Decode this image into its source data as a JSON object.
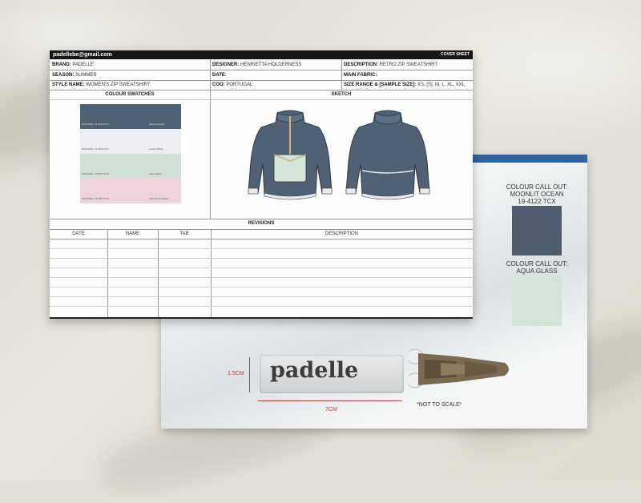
{
  "cover_sheet": {
    "email": "padellebe@gmail.com",
    "cover_label": "COVER SHEET",
    "fields": {
      "brand": {
        "label": "BRAND:",
        "value": "PADELLE"
      },
      "season": {
        "label": "SEASON:",
        "value": "SUMMER"
      },
      "style_name": {
        "label": "STYLE NAME:",
        "value": "WOMEN'S ZIP SWEATSHIRT"
      },
      "designer": {
        "label": "DESIGNER:",
        "value": "HENRIETTA HOLDERNESS"
      },
      "date": {
        "label": "DATE:",
        "value": ""
      },
      "coo": {
        "label": "COO:",
        "value": "PORTUGAL"
      },
      "description": {
        "label": "DESCRIPTION:",
        "value": "RETRO ZIP SWEATSHIRT"
      },
      "main_fabric": {
        "label": "MAIN FABRIC:",
        "value": ""
      },
      "size_range": {
        "label": "SIZE RANGE & [SAMPLE SIZE]:",
        "value": "XS, [S], M, L, XL, XXL"
      }
    },
    "colour_swatches_title": "COLOUR SWATCHES",
    "sketch_title": "SKETCH",
    "swatches": [
      {
        "brand": "PANTONE",
        "code": "19-4122 TCX",
        "name": "Moonlit Ocean",
        "color": "#4f6173"
      },
      {
        "brand": "PANTONE",
        "code": "11-4300 TCX",
        "name": "Lucent White",
        "color": "#eceef3"
      },
      {
        "brand": "PANTONE",
        "code": "13-6007 TCX",
        "name": "Aqua Glass",
        "color": "#cfe0d4"
      },
      {
        "brand": "PANTONE",
        "code": "13-2007 TCX",
        "name": "Pink Marshmallow",
        "color": "#ecd3dc"
      }
    ],
    "revisions_title": "REVISIONS",
    "revision_columns": [
      "DATE",
      "NAME",
      "TAB",
      "DESCRIPTION"
    ]
  },
  "back_sheet": {
    "callout_1": {
      "line1": "COLOUR CALL OUT:",
      "line2": "MOONLIT OCEAN",
      "line3": "19-4122 TCX",
      "color": "#4d5d6e"
    },
    "callout_2": {
      "line1": "COLOUR CALL OUT:",
      "line2": "AQUA GLASS",
      "color": "#d3e3d9"
    },
    "big_logo": "padelle",
    "pull_logo": "padelle",
    "height_dim": "1.5CM",
    "width_dim": "7CM",
    "not_to_scale": "*NOT TO SCALE*"
  },
  "colors": {
    "header_bar": "#161616",
    "accent_bar": "#2e63a0",
    "dimension": "#c0392b"
  }
}
